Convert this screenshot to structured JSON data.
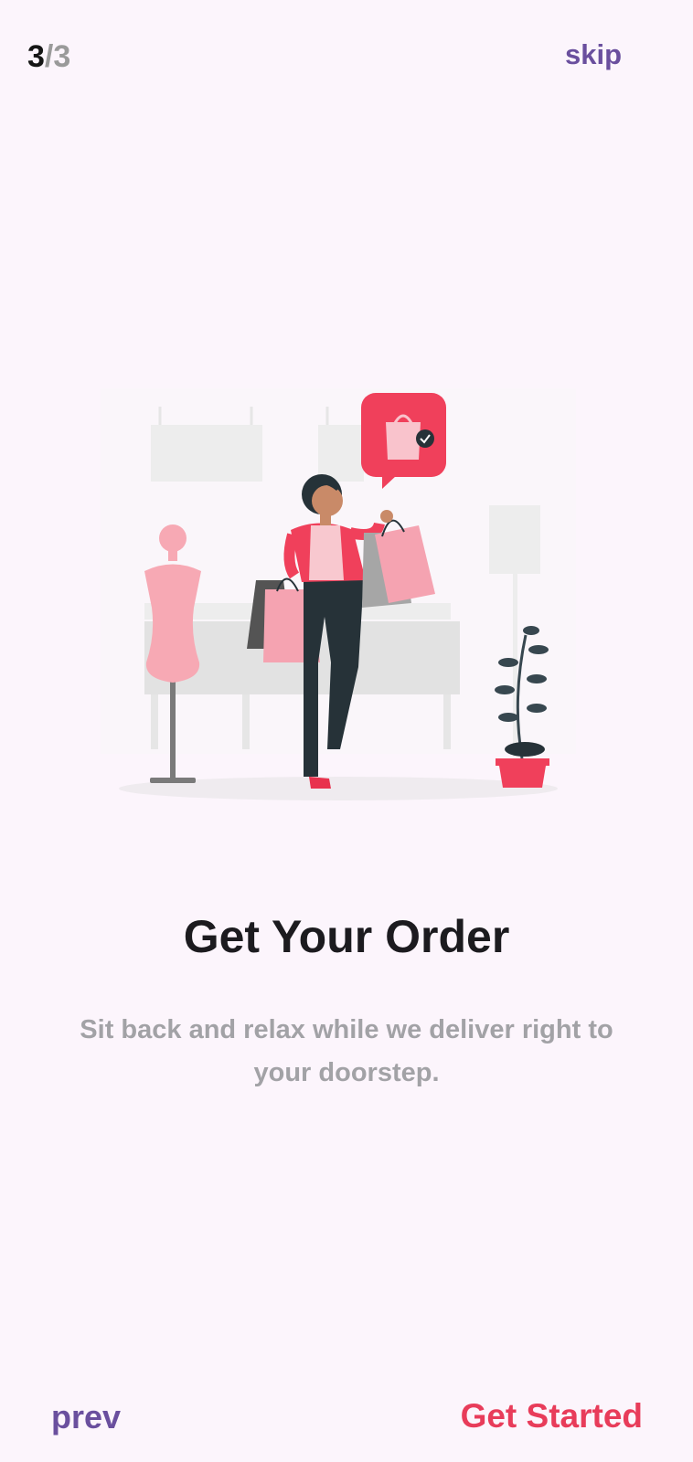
{
  "header": {
    "page_current": "3",
    "page_separator": "/",
    "page_total": "3",
    "skip_label": "skip"
  },
  "illustration": {
    "icon": "shopping-woman-illustration",
    "accent_color": "#F0405B"
  },
  "content": {
    "title": "Get Your Order",
    "subtitle": "Sit back and relax while we deliver right to your doorstep."
  },
  "footer": {
    "prev_label": "prev",
    "get_started_label": "Get Started"
  },
  "colors": {
    "background": "#FCF5FC",
    "primary_purple": "#6A4F9E",
    "accent_red": "#E83C5A",
    "muted_text": "#A2A2A6"
  }
}
